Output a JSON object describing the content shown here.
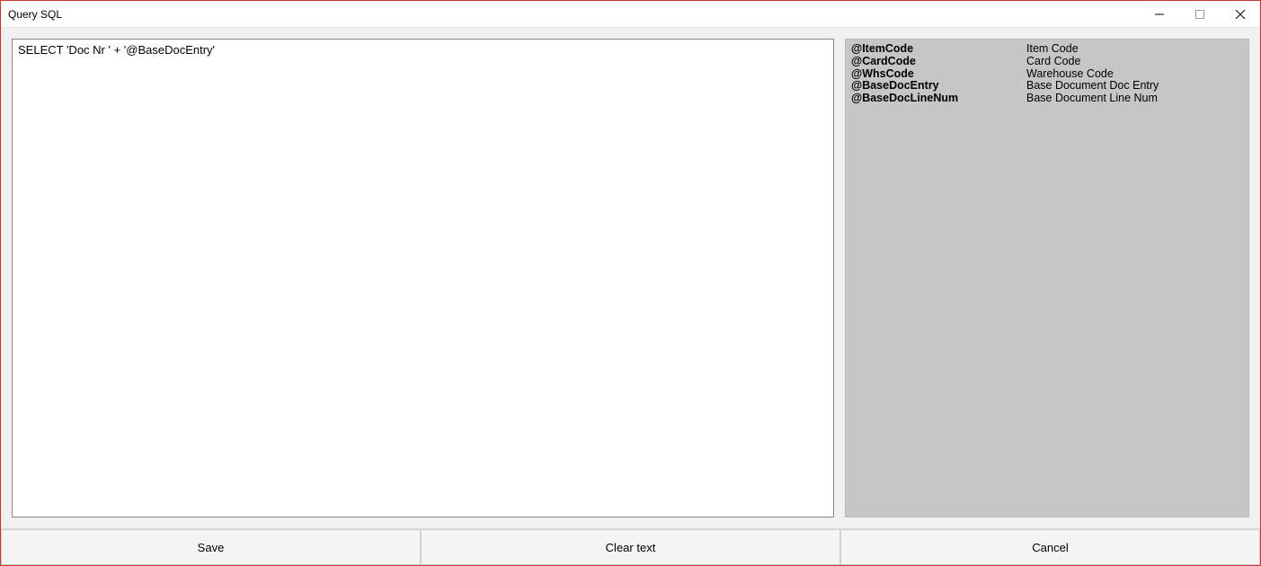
{
  "window": {
    "title": "Query SQL"
  },
  "editor": {
    "value": "SELECT 'Doc Nr ' + '@BaseDocEntry'"
  },
  "parameters": [
    {
      "code": "@ItemCode",
      "desc": "Item Code"
    },
    {
      "code": "@CardCode",
      "desc": "Card Code"
    },
    {
      "code": "@WhsCode",
      "desc": "Warehouse Code"
    },
    {
      "code": "@BaseDocEntry",
      "desc": "Base Document Doc Entry"
    },
    {
      "code": "@BaseDocLineNum",
      "desc": "Base Document Line Num"
    }
  ],
  "buttons": {
    "save": "Save",
    "clear": "Clear text",
    "cancel": "Cancel"
  }
}
